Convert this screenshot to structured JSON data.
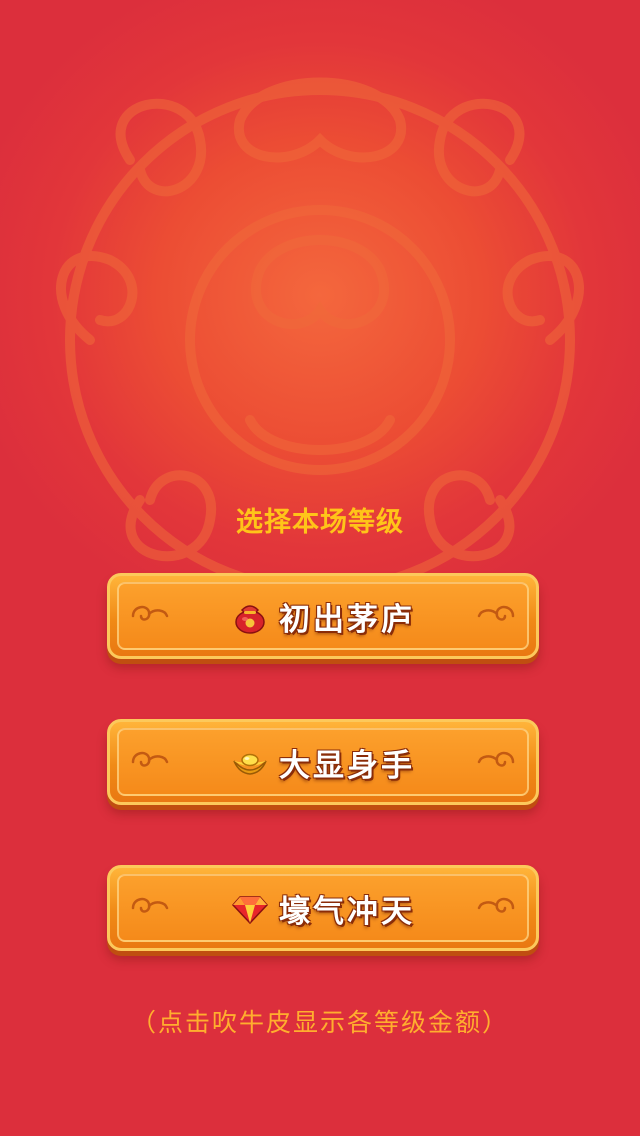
{
  "heading": "选择本场等级",
  "levels": [
    {
      "label": "初出茅庐",
      "icon": "money-bag-icon"
    },
    {
      "label": "大显身手",
      "icon": "gold-ingot-icon"
    },
    {
      "label": "壕气冲天",
      "icon": "diamond-icon"
    }
  ],
  "hint": "（点击吹牛皮显示各等级金额）",
  "colors": {
    "background": "#e2363a",
    "heading": "#ffc419",
    "button": "#f59322",
    "hint": "#ffae2e"
  }
}
